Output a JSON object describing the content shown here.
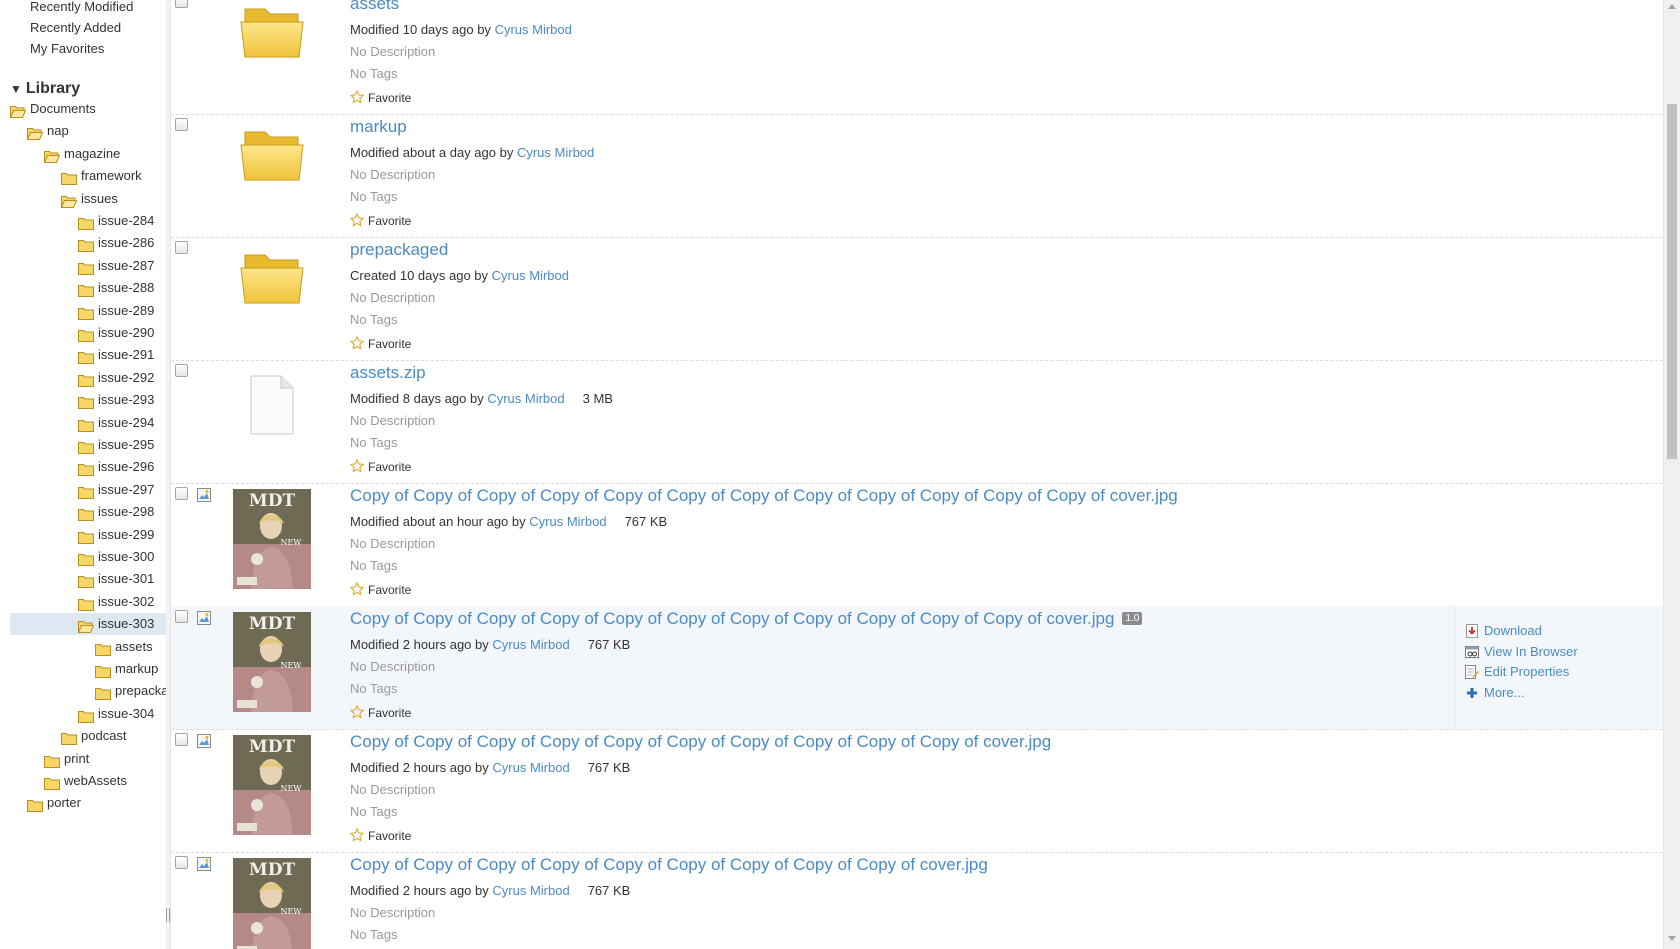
{
  "sidebar": {
    "quick_links": [
      "Recently Modified",
      "Recently Added",
      "My Favorites"
    ],
    "library_label": "Library",
    "tree": [
      {
        "label": "Documents",
        "level": 0,
        "open": true
      },
      {
        "label": "nap",
        "level": 1,
        "open": true
      },
      {
        "label": "magazine",
        "level": 2,
        "open": true
      },
      {
        "label": "framework",
        "level": 3,
        "open": false
      },
      {
        "label": "issues",
        "level": 3,
        "open": true
      },
      {
        "label": "issue-284",
        "level": 4,
        "open": false
      },
      {
        "label": "issue-286",
        "level": 4,
        "open": false
      },
      {
        "label": "issue-287",
        "level": 4,
        "open": false
      },
      {
        "label": "issue-288",
        "level": 4,
        "open": false
      },
      {
        "label": "issue-289",
        "level": 4,
        "open": false
      },
      {
        "label": "issue-290",
        "level": 4,
        "open": false
      },
      {
        "label": "issue-291",
        "level": 4,
        "open": false
      },
      {
        "label": "issue-292",
        "level": 4,
        "open": false
      },
      {
        "label": "issue-293",
        "level": 4,
        "open": false
      },
      {
        "label": "issue-294",
        "level": 4,
        "open": false
      },
      {
        "label": "issue-295",
        "level": 4,
        "open": false
      },
      {
        "label": "issue-296",
        "level": 4,
        "open": false
      },
      {
        "label": "issue-297",
        "level": 4,
        "open": false
      },
      {
        "label": "issue-298",
        "level": 4,
        "open": false
      },
      {
        "label": "issue-299",
        "level": 4,
        "open": false
      },
      {
        "label": "issue-300",
        "level": 4,
        "open": false
      },
      {
        "label": "issue-301",
        "level": 4,
        "open": false
      },
      {
        "label": "issue-302",
        "level": 4,
        "open": false
      },
      {
        "label": "issue-303",
        "level": 4,
        "open": true,
        "selected": true
      },
      {
        "label": "assets",
        "level": 5,
        "open": false
      },
      {
        "label": "markup",
        "level": 5,
        "open": false
      },
      {
        "label": "prepackaged",
        "level": 5,
        "open": false
      },
      {
        "label": "issue-304",
        "level": 4,
        "open": false
      },
      {
        "label": "podcast",
        "level": 3,
        "open": false
      },
      {
        "label": "print",
        "level": 2,
        "open": false
      },
      {
        "label": "webAssets",
        "level": 2,
        "open": false
      },
      {
        "label": "porter",
        "level": 1,
        "open": false
      }
    ]
  },
  "doclist": {
    "items": [
      {
        "name": "assets",
        "kind": "folder",
        "meta_prefix": "Modified 10 days ago by",
        "author": "Cyrus Mirbod",
        "size": "",
        "description": "No Description",
        "tags": "No Tags",
        "favorite_label": "Favorite"
      },
      {
        "name": "markup",
        "kind": "folder",
        "meta_prefix": "Modified about a day ago by",
        "author": "Cyrus Mirbod",
        "size": "",
        "description": "No Description",
        "tags": "No Tags",
        "favorite_label": "Favorite"
      },
      {
        "name": "prepackaged",
        "kind": "folder",
        "meta_prefix": "Created 10 days ago by",
        "author": "Cyrus Mirbod",
        "size": "",
        "description": "No Description",
        "tags": "No Tags",
        "favorite_label": "Favorite"
      },
      {
        "name": "assets.zip",
        "kind": "file",
        "meta_prefix": "Modified 8 days ago by",
        "author": "Cyrus Mirbod",
        "size": "3 MB",
        "description": "No Description",
        "tags": "No Tags",
        "favorite_label": "Favorite"
      },
      {
        "name": "Copy of Copy of Copy of Copy of Copy of Copy of Copy of Copy of Copy of Copy of Copy of Copy of cover.jpg",
        "kind": "image",
        "meta_prefix": "Modified about an hour ago by",
        "author": "Cyrus Mirbod",
        "size": "767 KB",
        "description": "No Description",
        "tags": "No Tags",
        "favorite_label": "Favorite"
      },
      {
        "name": "Copy of Copy of Copy of Copy of Copy of Copy of Copy of Copy of Copy of Copy of Copy of cover.jpg",
        "kind": "image",
        "version": "1.0",
        "meta_prefix": "Modified 2 hours ago by",
        "author": "Cyrus Mirbod",
        "size": "767 KB",
        "description": "No Description",
        "tags": "No Tags",
        "favorite_label": "Favorite",
        "hover": true
      },
      {
        "name": "Copy of Copy of Copy of Copy of Copy of Copy of Copy of Copy of Copy of Copy of cover.jpg",
        "kind": "image",
        "meta_prefix": "Modified 2 hours ago by",
        "author": "Cyrus Mirbod",
        "size": "767 KB",
        "description": "No Description",
        "tags": "No Tags",
        "favorite_label": "Favorite"
      },
      {
        "name": "Copy of Copy of Copy of Copy of Copy of Copy of Copy of Copy of Copy of cover.jpg",
        "kind": "image",
        "meta_prefix": "Modified 2 hours ago by",
        "author": "Cyrus Mirbod",
        "size": "767 KB",
        "description": "No Description",
        "tags": "No Tags",
        "favorite_label": "Favorite"
      }
    ],
    "hover_actions": [
      {
        "label": "Download",
        "icon": "download-icon"
      },
      {
        "label": "View In Browser",
        "icon": "view-in-browser-icon"
      },
      {
        "label": "Edit Properties",
        "icon": "edit-properties-icon"
      },
      {
        "label": "More...",
        "icon": "more-icon"
      }
    ]
  },
  "colors": {
    "link": "#4a8bc7",
    "selected_bg": "#dde8f3",
    "hover_bg": "#f3f7fc",
    "folder": "#f5cf4a"
  }
}
